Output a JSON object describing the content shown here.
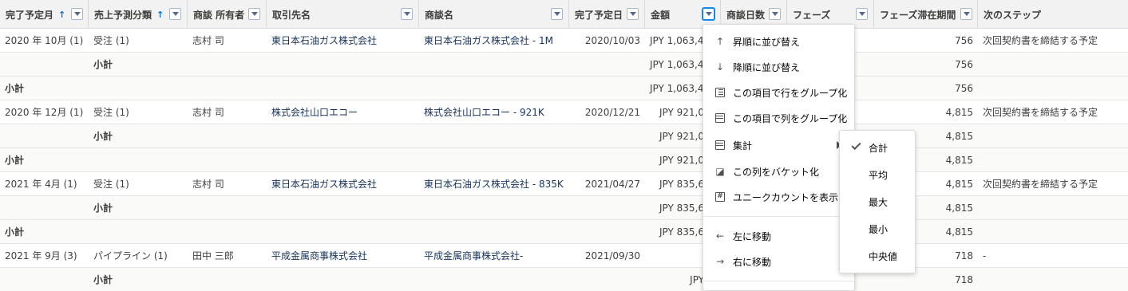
{
  "columns": [
    {
      "label": "完了予定月",
      "sort": "↑"
    },
    {
      "label": "売上予測分類",
      "sort": "↑"
    },
    {
      "label": "商談 所有者"
    },
    {
      "label": "取引先名"
    },
    {
      "label": "商談名"
    },
    {
      "label": "完了予定日"
    },
    {
      "label": "金額"
    },
    {
      "label": "商談日数"
    },
    {
      "label": "フェーズ"
    },
    {
      "label": "フェーズ滞在期間"
    },
    {
      "label": "次のステップ"
    }
  ],
  "rows": [
    {
      "type": "detail",
      "month": "2020 年 10月 (1)",
      "category": "受注 (1)",
      "owner": "志村 司",
      "account": "東日本石油ガス株式会社",
      "opportunity": "東日本石油ガス株式会社 - 1M",
      "close_date": "2020/10/03",
      "amount": "JPY 1,063,4",
      "stage_days": "756",
      "next_step": "次回契約書を締結する予定"
    },
    {
      "type": "sub",
      "category": "小計",
      "amount": "JPY 1,063,4",
      "stage_days": "756"
    },
    {
      "type": "grand",
      "month": "小計",
      "amount": "JPY 1,063,4",
      "stage_days": "756"
    },
    {
      "type": "detail",
      "month": "2020 年 12月 (1)",
      "category": "受注 (1)",
      "owner": "志村 司",
      "account": "株式会社山口エコー",
      "opportunity": "株式会社山口エコー - 921K",
      "close_date": "2020/12/21",
      "amount": "JPY 921,0",
      "stage_days": "4,815",
      "next_step": "次回契約書を締結する予定"
    },
    {
      "type": "sub",
      "category": "小計",
      "amount": "JPY 921,0",
      "stage_days": "4,815"
    },
    {
      "type": "grand",
      "month": "小計",
      "amount": "JPY 921,0",
      "stage_days": "4,815"
    },
    {
      "type": "detail",
      "month": "2021 年 4月 (1)",
      "category": "受注 (1)",
      "owner": "志村 司",
      "account": "東日本石油ガス株式会社",
      "opportunity": "東日本石油ガス株式会社 - 835K",
      "close_date": "2021/04/27",
      "amount": "JPY 835,6",
      "stage_days": "4,815",
      "next_step": "次回契約書を締結する予定"
    },
    {
      "type": "sub",
      "category": "小計",
      "amount": "JPY 835,6",
      "stage_days": "4,815"
    },
    {
      "type": "grand",
      "month": "小計",
      "amount": "JPY 835,6",
      "stage_days": "4,815"
    },
    {
      "type": "detail",
      "month": "2021 年 9月 (3)",
      "category": "パイプライン (1)",
      "owner": "田中 三郎",
      "account": "平成金属商事株式会社",
      "opportunity": "平成金属商事株式会社-",
      "close_date": "2021/09/30",
      "amount": "",
      "stage_days": "718",
      "next_step": "-"
    },
    {
      "type": "sub",
      "category": "小計",
      "amount": "JPY",
      "stage_days": "718"
    }
  ],
  "column_menu": {
    "items": [
      {
        "label": "昇順に並び替え",
        "icon": "arrow-up-icon"
      },
      {
        "label": "降順に並び替え",
        "icon": "arrow-down-icon"
      },
      {
        "label": "この項目で行をグループ化",
        "icon": "group-rows-icon"
      },
      {
        "label": "この項目で列をグループ化",
        "icon": "group-columns-icon"
      },
      {
        "label": "集計",
        "icon": "summarize-icon"
      },
      {
        "label": "この列をバケット化",
        "icon": "bucket-icon"
      },
      {
        "label": "ユニークカウントを表示",
        "icon": "hash-icon"
      },
      {
        "label": "左に移動",
        "icon": "arrow-left-icon"
      },
      {
        "label": "右に移動",
        "icon": "arrow-right-icon"
      }
    ]
  },
  "summarize_menu": {
    "items": [
      {
        "label": "合計",
        "checked": true
      },
      {
        "label": "平均"
      },
      {
        "label": "最大"
      },
      {
        "label": "最小"
      },
      {
        "label": "中央値"
      }
    ]
  }
}
